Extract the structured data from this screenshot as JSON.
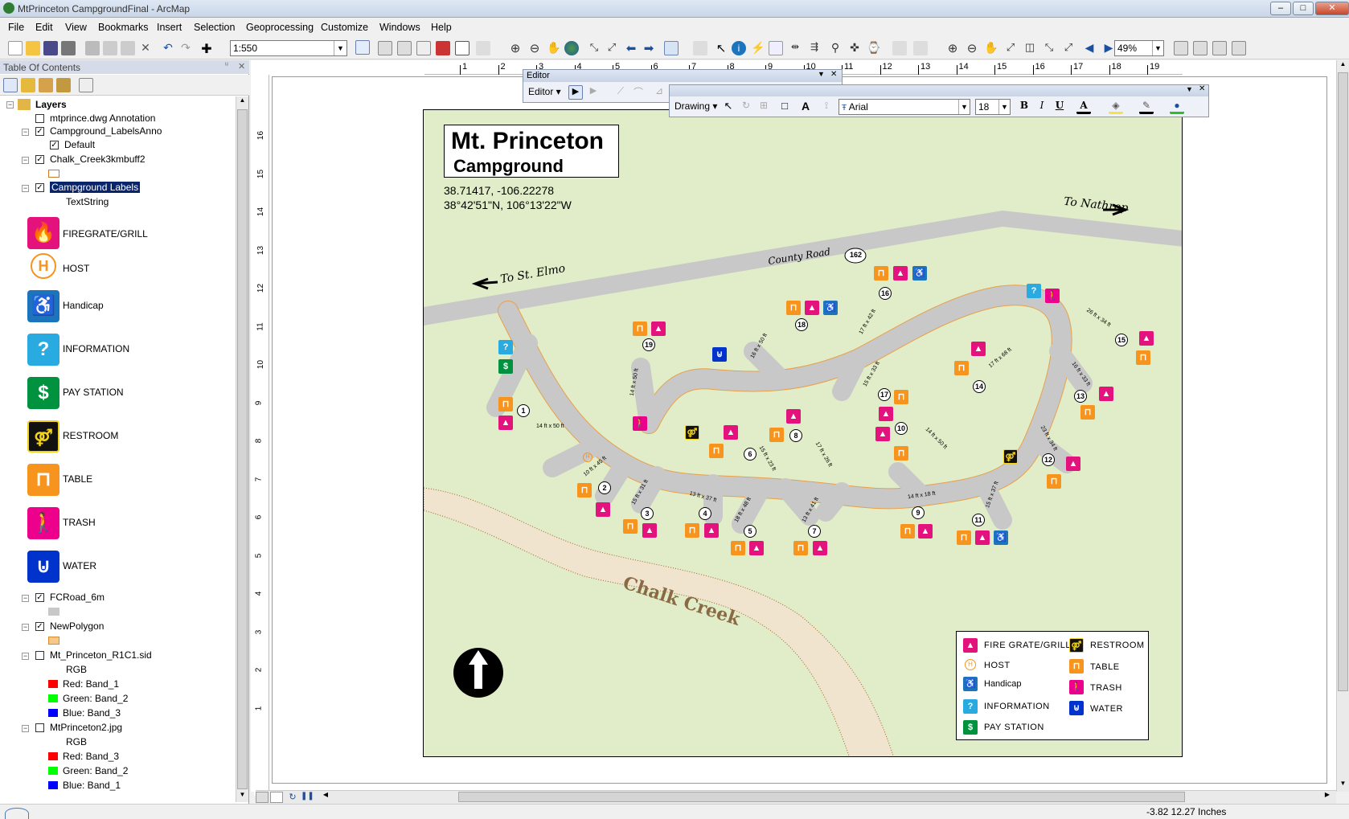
{
  "window": {
    "title": "MtPrinceton CampgroundFinal - ArcMap",
    "min": "–",
    "max": "□",
    "close": "✕"
  },
  "menu": [
    "File",
    "Edit",
    "View",
    "Bookmarks",
    "Insert",
    "Selection",
    "Geoprocessing",
    "Customize",
    "Windows",
    "Help"
  ],
  "toolbar": {
    "scale": "1:550",
    "zoom": "49%"
  },
  "toc": {
    "header": "Table Of Contents",
    "root": "Layers",
    "layers": {
      "annotation": "mtprince.dwg Annotation",
      "labelsanno": "Campground_LabelsAnno",
      "default": "Default",
      "chalk": "Chalk_Creek3kmbuff2",
      "labels": "Campground Labels",
      "textstring": "TextString",
      "fcroad": "FCRoad_6m",
      "newpoly": "NewPolygon",
      "sid": "Mt_Princeton_R1C1.sid",
      "rgb1": "RGB",
      "red1": "Red:   Band_1",
      "green1": "Green: Band_2",
      "blue1": "Blue:  Band_3",
      "jpg": "MtPrinceton2.jpg",
      "rgb2": "RGB",
      "red2": "Red:   Band_3",
      "green2": "Green: Band_2",
      "blue2": "Blue:  Band_1"
    },
    "legend": [
      "FIREGRATE/GRILL",
      "HOST",
      "Handicap",
      "INFORMATION",
      "PAY STATION",
      "RESTROOM",
      "TABLE",
      "TRASH",
      "WATER"
    ]
  },
  "ruler": {
    "h": [
      "1",
      "2",
      "3",
      "4",
      "5",
      "6",
      "7",
      "8",
      "9",
      "10",
      "11",
      "12",
      "13",
      "14",
      "15",
      "16",
      "17",
      "18",
      "19"
    ],
    "v": [
      "16",
      "15",
      "14",
      "13",
      "12",
      "11",
      "10",
      "9",
      "8",
      "7",
      "6",
      "5",
      "4",
      "3",
      "2",
      "1"
    ]
  },
  "editor": {
    "title": "Editor",
    "menu": "Editor ▾"
  },
  "drawing": {
    "menu": "Drawing ▾",
    "font": "Arial",
    "size": "18",
    "bold": "B",
    "italic": "I",
    "underline": "U",
    "fontcolor": "A"
  },
  "map": {
    "title1": "Mt. Princeton",
    "title2": "Campground",
    "coords1": "38.71417, -106.22278",
    "coords2": "38°42'51\"N, 106°13'22\"W",
    "to_nathrop": "To Nathrop",
    "to_stelmo": "To St. Elmo",
    "county_road": "County Road",
    "road_no": "162",
    "creek": "Chalk Creek",
    "legend": {
      "firegrate": "FIRE GRATE/GRILL",
      "host": "HOST",
      "handicap": "Handicap",
      "info": "INFORMATION",
      "pay": "PAY STATION",
      "restroom": "RESTROOM",
      "table": "TABLE",
      "trash": "TRASH",
      "water": "WATER"
    },
    "sites": [
      "1",
      "2",
      "3",
      "4",
      "5",
      "6",
      "7",
      "8",
      "9",
      "10",
      "11",
      "12",
      "13",
      "14",
      "15",
      "16",
      "17",
      "18",
      "19"
    ],
    "dims": [
      "14 ft x 50 ft",
      "10 ft x 45 ft",
      "15 ft x 31 ft",
      "13 ft x 37 ft",
      "18 ft x 48 ft",
      "15 ft x 23 ft",
      "13 ft x 41 ft",
      "17 ft x 26 ft",
      "14 ft x 18 ft",
      "14 ft x 50 ft",
      "15 ft x 37 ft",
      "23 ft x 34 ft",
      "16 ft x 33 ft",
      "17 ft x 68 ft",
      "26 ft x 34 ft",
      "17 ft x 42 ft",
      "15 ft x 33 ft",
      "16 ft x 50 ft",
      "14 ft x 50 ft"
    ]
  },
  "status": {
    "coords": "-3.82  12.27 Inches"
  },
  "colors": {
    "firegrate": "#e4127d",
    "host": "#f7941d",
    "handicap": "#1c75bc",
    "info": "#29abe2",
    "pay": "#00923f",
    "restroom": "#111111",
    "table": "#f7941d",
    "trash": "#ec008c",
    "water": "#0033cc",
    "map_bg": "#e1edc8",
    "road": "#c8c8c8"
  }
}
